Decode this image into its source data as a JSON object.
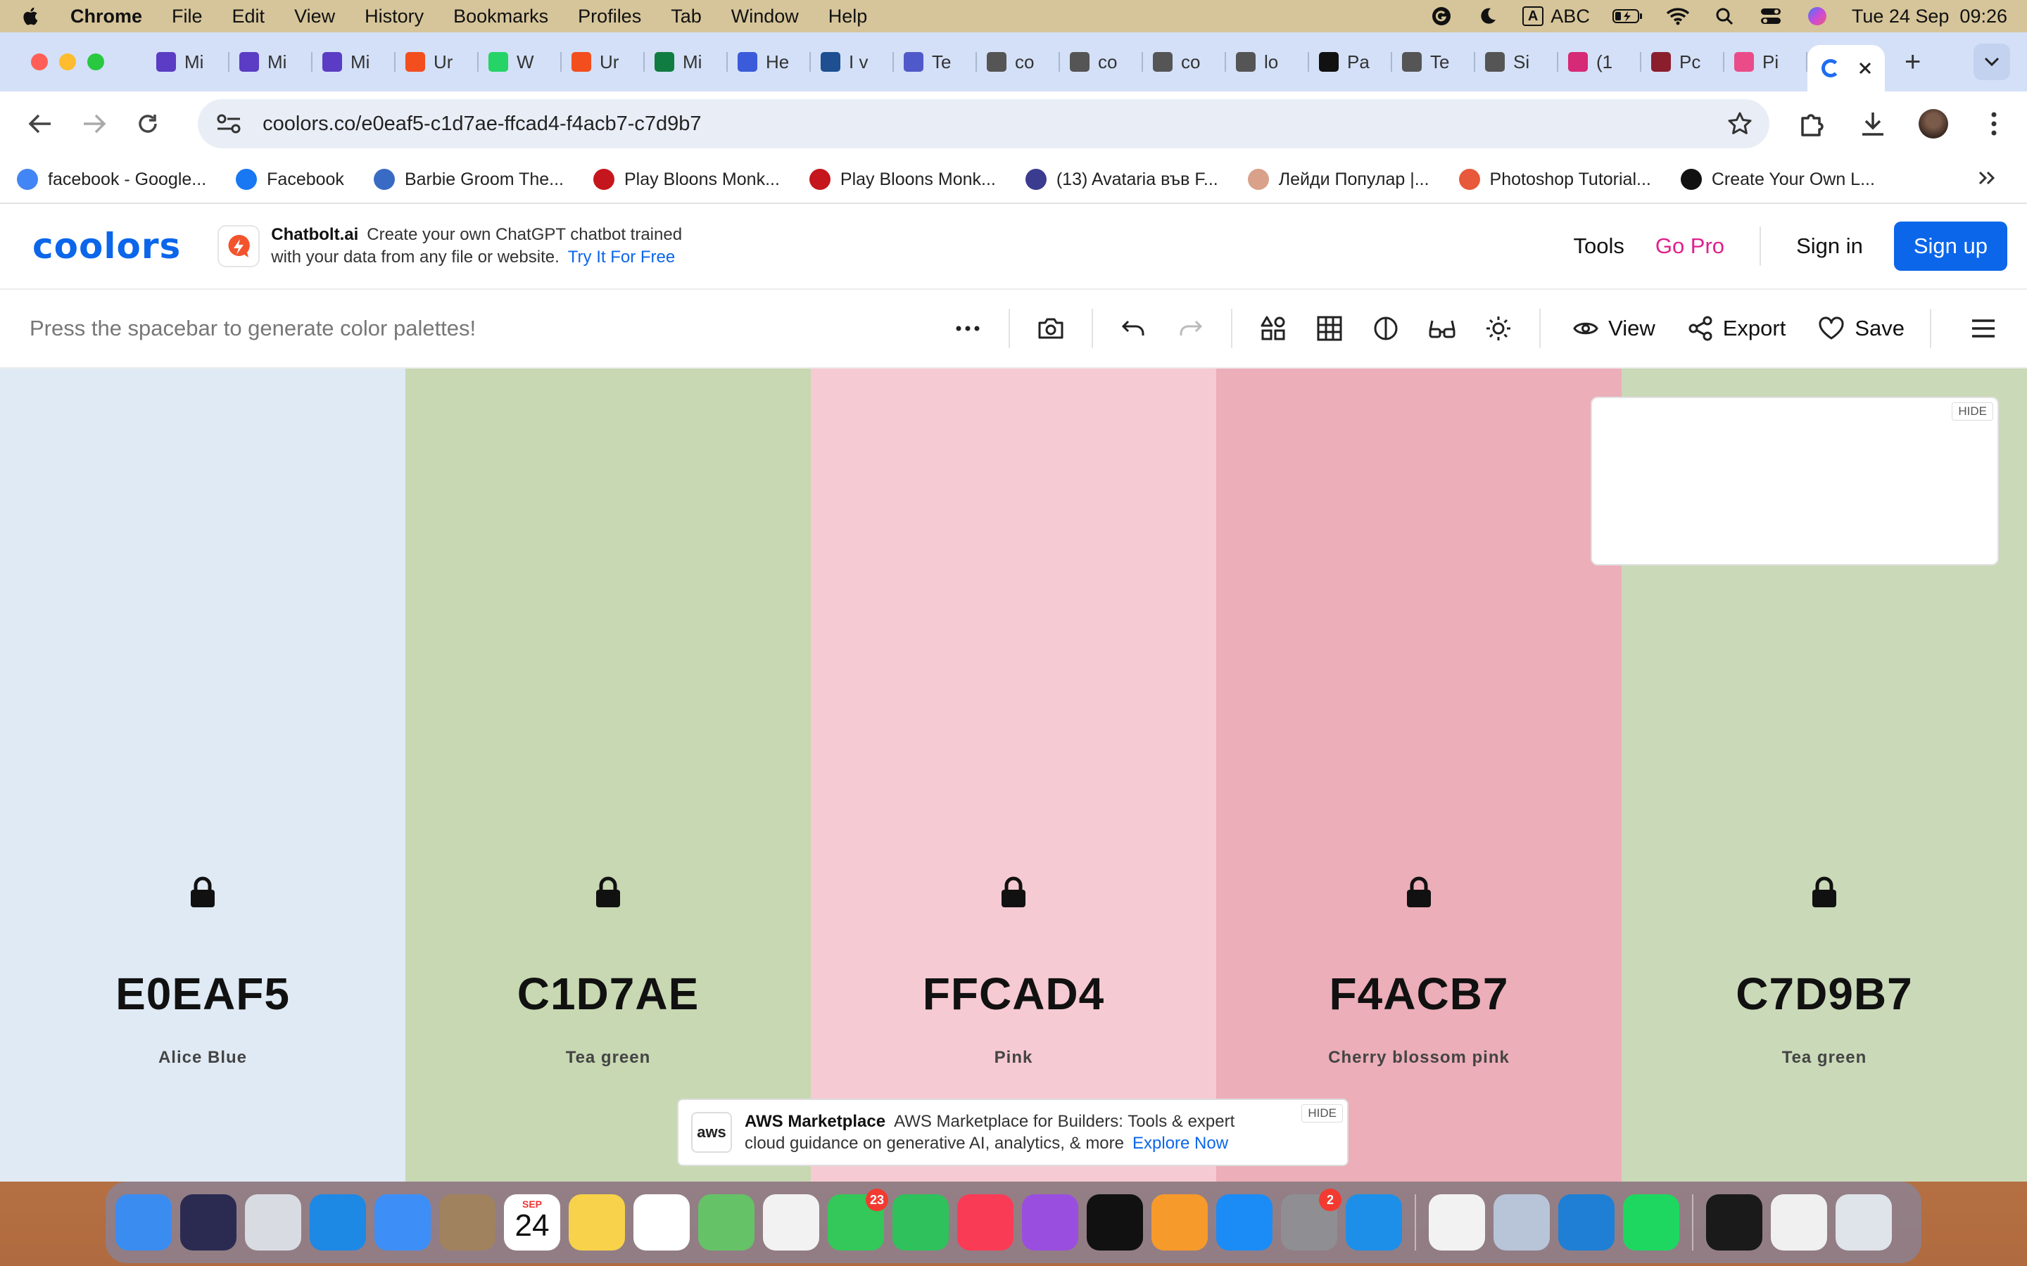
{
  "menubar": {
    "app_name": "Chrome",
    "items": [
      "File",
      "Edit",
      "View",
      "History",
      "Bookmarks",
      "Profiles",
      "Tab",
      "Window",
      "Help"
    ],
    "input_source": "ABC",
    "input_badge": "A",
    "datetime": "Tue 24 Sep  09:26"
  },
  "browser": {
    "tabs": [
      {
        "title": "Mi",
        "color": "#5b3cc4"
      },
      {
        "title": "Mi",
        "color": "#5b3cc4"
      },
      {
        "title": "Mi",
        "color": "#5b3cc4"
      },
      {
        "title": "Ur",
        "color": "#f24e1e"
      },
      {
        "title": "W",
        "color": "#25d366"
      },
      {
        "title": "Ur",
        "color": "#f24e1e"
      },
      {
        "title": "Mi",
        "color": "#107c41"
      },
      {
        "title": "He",
        "color": "#3b5bdb"
      },
      {
        "title": "I v",
        "color": "#1d4f91"
      },
      {
        "title": "Te",
        "color": "#5059c9"
      },
      {
        "title": "co",
        "color": "#555555"
      },
      {
        "title": "co",
        "color": "#555555"
      },
      {
        "title": "co",
        "color": "#555555"
      },
      {
        "title": "lo",
        "color": "#555555"
      },
      {
        "title": "Pa",
        "color": "#111111"
      },
      {
        "title": "Te",
        "color": "#555555"
      },
      {
        "title": "Si",
        "color": "#555555"
      },
      {
        "title": "(1",
        "color": "#d62976"
      },
      {
        "title": "Pc",
        "color": "#8b1e2d"
      },
      {
        "title": "Pi",
        "color": "#ea4c89"
      }
    ],
    "url": "coolors.co/e0eaf5-c1d7ae-ffcad4-f4acb7-c7d9b7",
    "bookmarks": [
      {
        "label": "facebook - Google...",
        "color": "#4285f4"
      },
      {
        "label": "Facebook",
        "color": "#1877f2"
      },
      {
        "label": "Barbie Groom The...",
        "color": "#3a6bc4"
      },
      {
        "label": "Play Bloons Monk...",
        "color": "#c4161c"
      },
      {
        "label": "Play Bloons Monk...",
        "color": "#c4161c"
      },
      {
        "label": "(13) Avataria във F...",
        "color": "#3b3b8f"
      },
      {
        "label": "Лейди Популар |...",
        "color": "#d9a08a"
      },
      {
        "label": "Photoshop Tutorial...",
        "color": "#e8583a"
      },
      {
        "label": "Create Your Own L...",
        "color": "#111111"
      }
    ]
  },
  "header": {
    "logo": "coolors",
    "ad_brand": "Chatbolt.ai",
    "ad_line1": "Create your own ChatGPT chatbot trained",
    "ad_line2": "with your data from any file or website.",
    "ad_cta": "Try It For Free",
    "tools": "Tools",
    "go_pro": "Go Pro",
    "sign_in": "Sign in",
    "sign_up": "Sign up"
  },
  "generator": {
    "hint": "Press the spacebar to generate color palettes!",
    "view": "View",
    "export": "Export",
    "save": "Save"
  },
  "palette": [
    {
      "hex": "E0EAF5",
      "name": "Alice Blue",
      "color": "#e0eaf5"
    },
    {
      "hex": "C1D7AE",
      "name": "Tea green",
      "color": "#c8d8b2"
    },
    {
      "hex": "FFCAD4",
      "name": "Pink",
      "color": "#f6cad3"
    },
    {
      "hex": "F4ACB7",
      "name": "Cherry blossom pink",
      "color": "#ecaeb9"
    },
    {
      "hex": "C7D9B7",
      "name": "Tea green",
      "color": "#cad9b8"
    }
  ],
  "ads": {
    "hide_label": "HIDE",
    "aws_logo": "aws",
    "aws_brand": "AWS Marketplace",
    "aws_line1": "AWS Marketplace for Builders: Tools & expert",
    "aws_line2": "cloud guidance on generative AI, analytics, & more",
    "aws_cta": "Explore Now"
  },
  "dock": {
    "calendar_month": "SEP",
    "calendar_day": "24",
    "messages_badge": "23",
    "settings_badge": "2",
    "apps": [
      {
        "name": "Finder",
        "color": "#3b8cf0"
      },
      {
        "name": "Siri",
        "color": "#2b2b52"
      },
      {
        "name": "Launchpad",
        "color": "#d8dbe2"
      },
      {
        "name": "Safari",
        "color": "#1e88e5"
      },
      {
        "name": "Mail",
        "color": "#3d8ef7"
      },
      {
        "name": "Contacts",
        "color": "#a0825e"
      },
      {
        "name": "Calendar",
        "color": "#ffffff"
      },
      {
        "name": "Notes",
        "color": "#f7d24a"
      },
      {
        "name": "Reminders",
        "color": "#ffffff"
      },
      {
        "name": "Maps",
        "color": "#66c267"
      },
      {
        "name": "Photos",
        "color": "#f2f2f2"
      },
      {
        "name": "Messages",
        "color": "#34c759"
      },
      {
        "name": "FaceTime",
        "color": "#2fc15b"
      },
      {
        "name": "Music",
        "color": "#fa3b56"
      },
      {
        "name": "Podcasts",
        "color": "#9a4ee0"
      },
      {
        "name": "TV",
        "color": "#111111"
      },
      {
        "name": "Books",
        "color": "#f79a2c"
      },
      {
        "name": "App Store",
        "color": "#1b8cf5"
      },
      {
        "name": "System Settings",
        "color": "#8e8e93"
      },
      {
        "name": "Docker",
        "color": "#1d8fe8"
      },
      {
        "name": "Chrome",
        "color": "#f2f2f2"
      },
      {
        "name": "Preview",
        "color": "#b8c4d8"
      },
      {
        "name": "VS Code",
        "color": "#1f7fd4"
      },
      {
        "name": "Spotify",
        "color": "#1ed760"
      },
      {
        "name": "Window 1",
        "color": "#1a1a1a"
      },
      {
        "name": "Window 2",
        "color": "#f0f0f0"
      },
      {
        "name": "Trash",
        "color": "#dfe3ea"
      }
    ]
  }
}
